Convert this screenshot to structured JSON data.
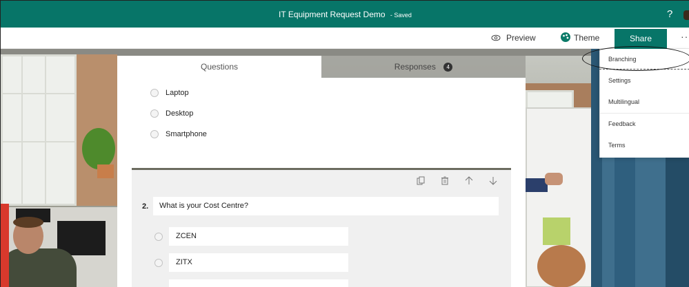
{
  "header": {
    "title": "IT Equipment Request Demo",
    "saved_label": "- Saved",
    "help_label": "?"
  },
  "command_bar": {
    "preview_label": "Preview",
    "theme_label": "Theme",
    "share_label": "Share",
    "more_label": "···"
  },
  "tabs": {
    "questions_label": "Questions",
    "responses_label": "Responses",
    "responses_count": "4"
  },
  "question1": {
    "options": [
      "Laptop",
      "Desktop",
      "Smartphone"
    ]
  },
  "question2": {
    "number": "2.",
    "title": "What is your Cost Centre?",
    "choices": [
      "ZCEN",
      "ZITX",
      ""
    ]
  },
  "menu": {
    "items": [
      "Branching",
      "Settings",
      "Multilingual",
      "Feedback",
      "Terms"
    ]
  },
  "colors": {
    "brand": "#077568",
    "annotation": "#111111"
  }
}
